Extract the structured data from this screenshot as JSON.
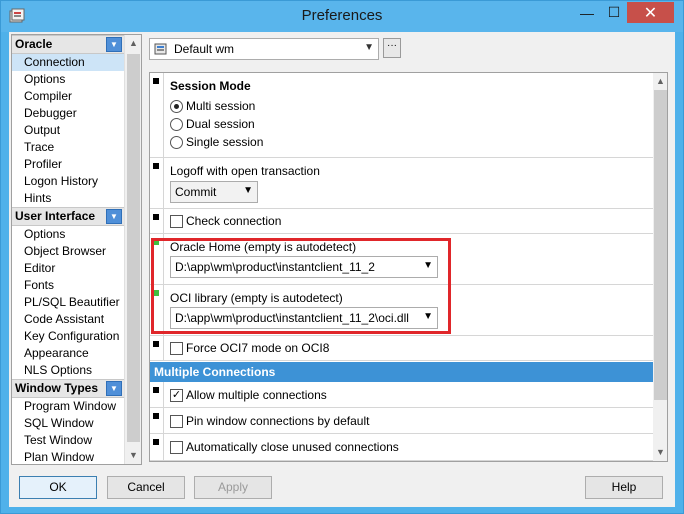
{
  "window": {
    "title": "Preferences",
    "minimize_glyph": "—",
    "maximize_glyph": "☐",
    "close_glyph": "✕"
  },
  "nav": {
    "groups": [
      {
        "label": "Oracle",
        "items": [
          "Connection",
          "Options",
          "Compiler",
          "Debugger",
          "Output",
          "Trace",
          "Profiler",
          "Logon History",
          "Hints"
        ]
      },
      {
        "label": "User Interface",
        "items": [
          "Options",
          "Object Browser",
          "Editor",
          "Fonts",
          "PL/SQL Beautifier",
          "Code Assistant",
          "Key Configuration",
          "Appearance",
          "NLS Options"
        ]
      },
      {
        "label": "Window Types",
        "items": [
          "Program Window",
          "SQL Window",
          "Test Window",
          "Plan Window"
        ]
      }
    ],
    "selected": "Connection"
  },
  "profile": {
    "value": "Default wm",
    "more_label": "···"
  },
  "settings": {
    "session_mode": {
      "heading": "Session Mode",
      "options": [
        "Multi session",
        "Dual session",
        "Single session"
      ],
      "selected": "Multi session"
    },
    "logoff": {
      "label": "Logoff with open transaction",
      "value": "Commit"
    },
    "check_connection": {
      "label": "Check connection",
      "checked": false
    },
    "oracle_home": {
      "label": "Oracle Home (empty is autodetect)",
      "value": "D:\\app\\wm\\product\\instantclient_11_2"
    },
    "oci_library": {
      "label": "OCI library (empty is autodetect)",
      "value": "D:\\app\\wm\\product\\instantclient_11_2\\oci.dll"
    },
    "force_oci7": {
      "label": "Force OCI7 mode on OCI8",
      "checked": false
    },
    "multiple_connections": {
      "heading": "Multiple Connections",
      "allow": {
        "label": "Allow multiple connections",
        "checked": true
      },
      "pin": {
        "label": "Pin window connections by default",
        "checked": false
      },
      "auto_close": {
        "label": "Automatically close unused connections",
        "checked": false
      }
    }
  },
  "buttons": {
    "ok": "OK",
    "cancel": "Cancel",
    "apply": "Apply",
    "help": "Help"
  },
  "colors": {
    "title_bar": "#59b5ec",
    "section_bar": "#3d92d6",
    "highlight": "#e0262a",
    "close_button": "#c7504a"
  }
}
